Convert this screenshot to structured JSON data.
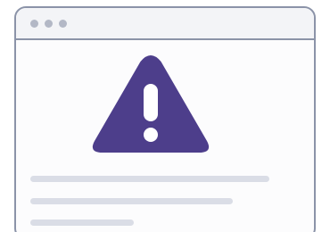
{
  "window": {
    "title_bar_dots": [
      "dot",
      "dot",
      "dot"
    ]
  },
  "illustration": {
    "icon": "warning-icon",
    "triangle_color": "#4d3e8b",
    "mark_color": "#ffffff"
  },
  "content_placeholder": {
    "line_color": "#dadde6",
    "lines": 3
  }
}
